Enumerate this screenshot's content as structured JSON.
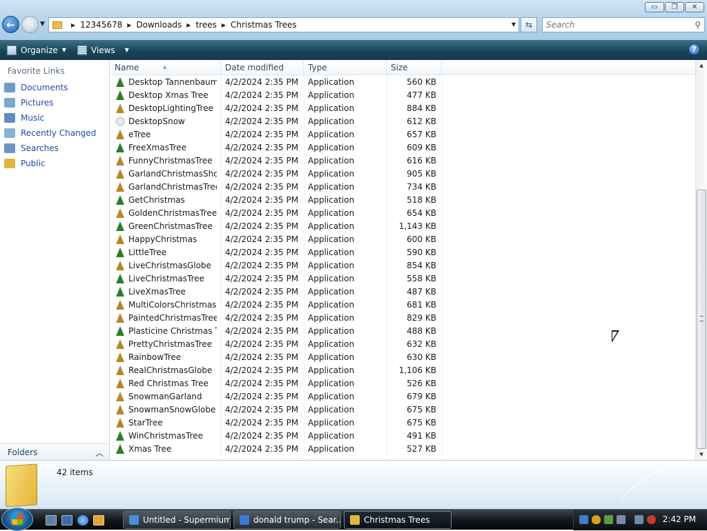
{
  "window": {
    "caption_buttons": {
      "minimize": "▭",
      "maximize": "❐",
      "close": "✕"
    }
  },
  "nav": {
    "back": "←",
    "forward": "→"
  },
  "address": {
    "crumbs": [
      "12345678",
      "Downloads",
      "trees",
      "Christmas Trees"
    ]
  },
  "search": {
    "placeholder": "Search"
  },
  "toolbar": {
    "organize": "Organize",
    "views": "Views",
    "help": "?"
  },
  "sidebar": {
    "title": "Favorite Links",
    "items": [
      {
        "label": "Documents",
        "icon": "documents-icon",
        "color": "#6f9bc7"
      },
      {
        "label": "Pictures",
        "icon": "pictures-icon",
        "color": "#7fa7cc"
      },
      {
        "label": "Music",
        "icon": "music-icon",
        "color": "#5f8fc0"
      },
      {
        "label": "Recently Changed",
        "icon": "recent-icon",
        "color": "#8cb1d4"
      },
      {
        "label": "Searches",
        "icon": "searches-icon",
        "color": "#6d95bf"
      },
      {
        "label": "Public",
        "icon": "public-folder-icon",
        "color": "#e3b53a"
      }
    ],
    "folders_label": "Folders"
  },
  "columns": {
    "name": "Name",
    "date": "Date modified",
    "type": "Type",
    "size": "Size"
  },
  "files": [
    {
      "name": "Desktop Tannenbaum",
      "date": "4/2/2024 2:35 PM",
      "type": "Application",
      "size": "560 KB",
      "icon": "green"
    },
    {
      "name": "Desktop Xmas Tree",
      "date": "4/2/2024 2:35 PM",
      "type": "Application",
      "size": "477 KB",
      "icon": "green"
    },
    {
      "name": "DesktopLightingTree",
      "date": "4/2/2024 2:35 PM",
      "type": "Application",
      "size": "884 KB",
      "icon": "gold"
    },
    {
      "name": "DesktopSnow",
      "date": "4/2/2024 2:35 PM",
      "type": "Application",
      "size": "612 KB",
      "icon": "snow"
    },
    {
      "name": "eTree",
      "date": "4/2/2024 2:35 PM",
      "type": "Application",
      "size": "657 KB",
      "icon": "gold"
    },
    {
      "name": "FreeXmasTree",
      "date": "4/2/2024 2:35 PM",
      "type": "Application",
      "size": "609 KB",
      "icon": "green"
    },
    {
      "name": "FunnyChristmasTree",
      "date": "4/2/2024 2:35 PM",
      "type": "Application",
      "size": "616 KB",
      "icon": "gold"
    },
    {
      "name": "GarlandChristmasShow",
      "date": "4/2/2024 2:35 PM",
      "type": "Application",
      "size": "905 KB",
      "icon": "gold"
    },
    {
      "name": "GarlandChristmasTree",
      "date": "4/2/2024 2:35 PM",
      "type": "Application",
      "size": "734 KB",
      "icon": "gold"
    },
    {
      "name": "GetChristmas",
      "date": "4/2/2024 2:35 PM",
      "type": "Application",
      "size": "518 KB",
      "icon": "green"
    },
    {
      "name": "GoldenChristmasTree",
      "date": "4/2/2024 2:35 PM",
      "type": "Application",
      "size": "654 KB",
      "icon": "gold"
    },
    {
      "name": "GreenChristmasTree",
      "date": "4/2/2024 2:35 PM",
      "type": "Application",
      "size": "1,143 KB",
      "icon": "green"
    },
    {
      "name": "HappyChristmas",
      "date": "4/2/2024 2:35 PM",
      "type": "Application",
      "size": "600 KB",
      "icon": "gold"
    },
    {
      "name": "LittleTree",
      "date": "4/2/2024 2:35 PM",
      "type": "Application",
      "size": "590 KB",
      "icon": "green"
    },
    {
      "name": "LiveChristmasGlobe",
      "date": "4/2/2024 2:35 PM",
      "type": "Application",
      "size": "854 KB",
      "icon": "gold"
    },
    {
      "name": "LiveChristmasTree",
      "date": "4/2/2024 2:35 PM",
      "type": "Application",
      "size": "558 KB",
      "icon": "green"
    },
    {
      "name": "LiveXmasTree",
      "date": "4/2/2024 2:35 PM",
      "type": "Application",
      "size": "487 KB",
      "icon": "green"
    },
    {
      "name": "MultiColorsChristmas...",
      "date": "4/2/2024 2:35 PM",
      "type": "Application",
      "size": "681 KB",
      "icon": "gold"
    },
    {
      "name": "PaintedChristmasTree",
      "date": "4/2/2024 2:35 PM",
      "type": "Application",
      "size": "829 KB",
      "icon": "gold"
    },
    {
      "name": "Plasticine Christmas Tr...",
      "date": "4/2/2024 2:35 PM",
      "type": "Application",
      "size": "488 KB",
      "icon": "green"
    },
    {
      "name": "PrettyChristmasTree",
      "date": "4/2/2024 2:35 PM",
      "type": "Application",
      "size": "632 KB",
      "icon": "gold"
    },
    {
      "name": "RainbowTree",
      "date": "4/2/2024 2:35 PM",
      "type": "Application",
      "size": "630 KB",
      "icon": "gold"
    },
    {
      "name": "RealChristmasGlobe",
      "date": "4/2/2024 2:35 PM",
      "type": "Application",
      "size": "1,106 KB",
      "icon": "gold"
    },
    {
      "name": "Red Christmas Tree",
      "date": "4/2/2024 2:35 PM",
      "type": "Application",
      "size": "526 KB",
      "icon": "gold"
    },
    {
      "name": "SnowmanGarland",
      "date": "4/2/2024 2:35 PM",
      "type": "Application",
      "size": "679 KB",
      "icon": "gold"
    },
    {
      "name": "SnowmanSnowGlobe",
      "date": "4/2/2024 2:35 PM",
      "type": "Application",
      "size": "675 KB",
      "icon": "gold"
    },
    {
      "name": "StarTree",
      "date": "4/2/2024 2:35 PM",
      "type": "Application",
      "size": "675 KB",
      "icon": "gold"
    },
    {
      "name": "WinChristmasTree",
      "date": "4/2/2024 2:35 PM",
      "type": "Application",
      "size": "491 KB",
      "icon": "green"
    },
    {
      "name": "Xmas Tree",
      "date": "4/2/2024 2:35 PM",
      "type": "Application",
      "size": "527 KB",
      "icon": "green"
    }
  ],
  "details": {
    "item_count": "42 items"
  },
  "taskbar": {
    "tasks": [
      {
        "label": "Untitled - Supermium",
        "icon": "supermium-icon",
        "color": "#4a8fd6"
      },
      {
        "label": "donald trump - Sear...",
        "icon": "browser-icon",
        "color": "#3a7bd5"
      },
      {
        "label": "Christmas Trees",
        "icon": "folder-icon",
        "color": "#e3b53a"
      }
    ],
    "active_task": "Christmas Trees",
    "clock": "2:42 PM"
  },
  "colors": {
    "link": "#1b4fa0",
    "toolbar": "#1a4659",
    "accent": "#1f5fb5"
  }
}
